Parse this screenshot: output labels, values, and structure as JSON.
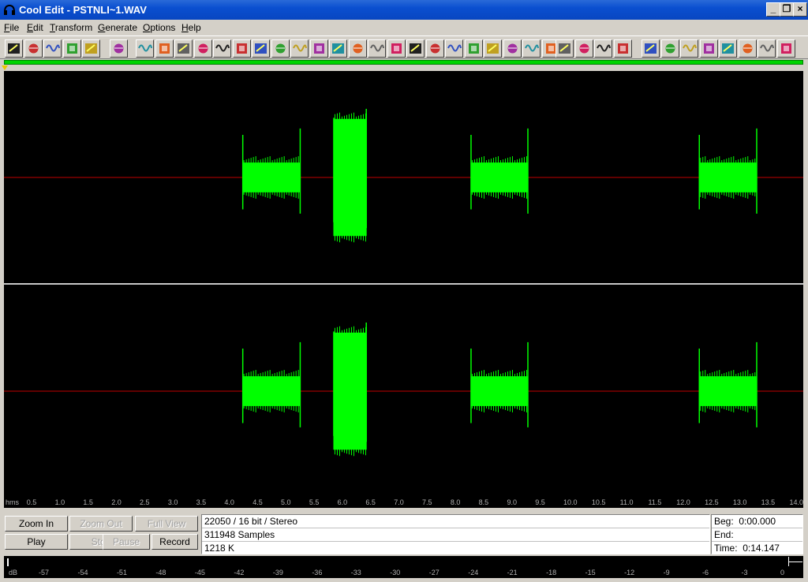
{
  "window": {
    "title": "Cool Edit - PSTNLI~1.WAV",
    "minimize_glyph": "_",
    "restore_glyph": "❐",
    "close_glyph": "×"
  },
  "menu": [
    {
      "label": "File",
      "key": "F",
      "rest": "ile"
    },
    {
      "label": "Edit",
      "key": "E",
      "rest": "dit"
    },
    {
      "label": "Transform",
      "key": "T",
      "rest": "ransform"
    },
    {
      "label": "Generate",
      "key": "G",
      "rest": "enerate"
    },
    {
      "label": "Options",
      "key": "O",
      "rest": "ptions"
    },
    {
      "label": "Help",
      "key": "H",
      "rest": "elp"
    }
  ],
  "toolbar_icons": [
    "new-icon",
    "open-icon",
    "save-icon",
    "record-to-file-icon",
    "play-to-file-icon",
    "edit-icon",
    "reverse-icon",
    "silence-icon",
    "invert-icon",
    "music-note-icon",
    "record-dot-icon",
    "channel-mixer-icon",
    "amplify-icon",
    "timer-icon",
    "envelope-icon",
    "echo-icon",
    "delay-icon",
    "alert-icon",
    "filter-icon",
    "noise-icon",
    "fft-icon",
    "graphic-eq-icon",
    "dynamics-icon",
    "spectrum-icon",
    "point-icon",
    "wave-icon",
    "phaser-icon",
    "wave-surf-icon",
    "mix-icon",
    "stretch-icon",
    "pitch-icon",
    "distort-icon",
    "loop-icon",
    "levels-icon",
    "cue-icon",
    "zoom-tool-icon",
    "text-cursor-icon",
    "script-icon",
    "help-icon",
    "about-icon"
  ],
  "time_ruler": {
    "unit_label": "hms",
    "ticks": [
      "0.5",
      "1.0",
      "1.5",
      "2.0",
      "2.5",
      "3.0",
      "3.5",
      "4.0",
      "4.5",
      "5.0",
      "5.5",
      "6.0",
      "6.5",
      "7.0",
      "7.5",
      "8.0",
      "8.5",
      "9.0",
      "9.5",
      "10.0",
      "10.5",
      "11.0",
      "11.5",
      "12.0",
      "12.5",
      "13.0",
      "13.5",
      "14.0"
    ]
  },
  "waveform": {
    "duration_seconds": 14.147,
    "channels": 2,
    "bursts": [
      {
        "start": 4.22,
        "end": 5.25,
        "level": 0.14,
        "peak": 0.4
      },
      {
        "start": 5.83,
        "end": 6.42,
        "level": 0.55,
        "peak": 0.56
      },
      {
        "start": 8.26,
        "end": 9.28,
        "level": 0.14,
        "peak": 0.4
      },
      {
        "start": 12.3,
        "end": 13.33,
        "level": 0.14,
        "peak": 0.4
      }
    ],
    "wave_color": "#00ff00",
    "centerline_color": "#c00000",
    "divider_color": "#c8c8c8"
  },
  "controls": {
    "zoom_in": "Zoom In",
    "zoom_out": "Zoom Out",
    "full_view": "Full View",
    "play": "Play",
    "stop": "Stop",
    "pause": "Pause",
    "record": "Record"
  },
  "file_info": {
    "format": "22050 / 16 bit / Stereo",
    "samples": "311948 Samples",
    "size": "1218 K"
  },
  "time_info": {
    "beg_label": "Beg:",
    "beg_value": "0:00.000",
    "end_label": "End:",
    "end_value": "",
    "time_label": "Time:",
    "time_value": "0:14.147"
  },
  "db_scale": {
    "unit_label": "dB",
    "ticks": [
      "-57",
      "-54",
      "-51",
      "-48",
      "-45",
      "-42",
      "-39",
      "-36",
      "-33",
      "-30",
      "-27",
      "-24",
      "-21",
      "-18",
      "-15",
      "-12",
      "-9",
      "-6",
      "-3",
      "0"
    ]
  }
}
